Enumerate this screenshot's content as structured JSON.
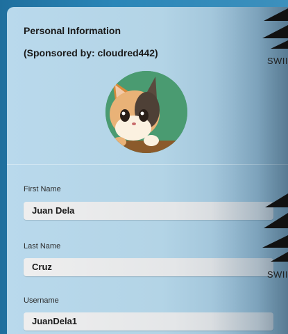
{
  "header": {
    "title": "Personal Information",
    "sponsor": "(Sponsored by: cloudred442)"
  },
  "avatar": {
    "icon": "cat-avatar-icon"
  },
  "form": {
    "first_name": {
      "label": "First Name",
      "value": "Juan Dela"
    },
    "last_name": {
      "label": "Last Name",
      "value": "Cruz"
    },
    "username": {
      "label": "Username",
      "value": "JuanDela1"
    }
  },
  "watermark": {
    "text_top": "SWII",
    "text_bottom": "SWII"
  }
}
